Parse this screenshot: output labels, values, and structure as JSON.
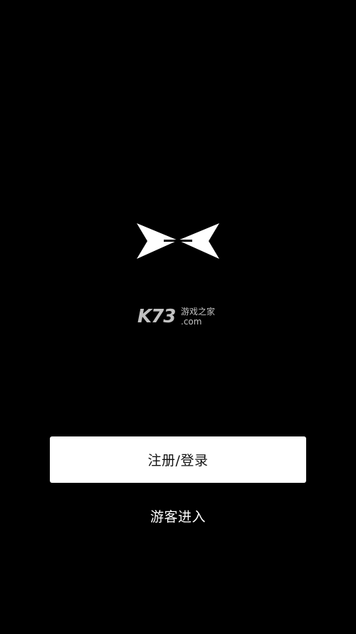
{
  "logo": {
    "icon": "x-wings-logo-icon",
    "color": "#ffffff"
  },
  "watermark": {
    "brand": "K73",
    "cn_name": "游戏之家",
    "domain": ".com",
    "color": "#d8d8d8"
  },
  "actions": {
    "login_label": "注册/登录",
    "guest_label": "游客进入"
  },
  "theme": {
    "background": "#000000",
    "button_bg": "#ffffff",
    "button_text": "#111111",
    "guest_text": "#ffffff"
  }
}
